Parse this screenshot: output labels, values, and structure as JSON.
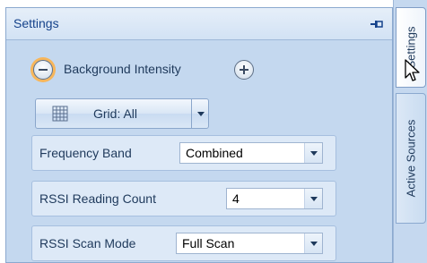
{
  "panel": {
    "title": "Settings"
  },
  "background_intensity": {
    "label": "Background Intensity"
  },
  "grid": {
    "label": "Grid: All"
  },
  "fields": {
    "frequency_band": {
      "label": "Frequency Band",
      "value": "Combined"
    },
    "rssi_reading_count": {
      "label": "RSSI Reading Count",
      "value": "4"
    },
    "rssi_scan_mode": {
      "label": "RSSI Scan Mode",
      "value": "Full Scan"
    }
  },
  "tabs": [
    {
      "label": "Settings",
      "active": true
    },
    {
      "label": "Active Sources",
      "active": false
    }
  ],
  "icons": {
    "pin": "pin-icon",
    "minus": "minus-circle-icon",
    "plus": "plus-circle-icon",
    "grid": "grid-icon",
    "dropdown": "chevron-down-icon",
    "cursor": "mouse-cursor-icon"
  },
  "colors": {
    "panel_bg": "#c4d8ef",
    "header_text": "#15428b",
    "text": "#1e395b",
    "highlight": "#f7b65b"
  }
}
